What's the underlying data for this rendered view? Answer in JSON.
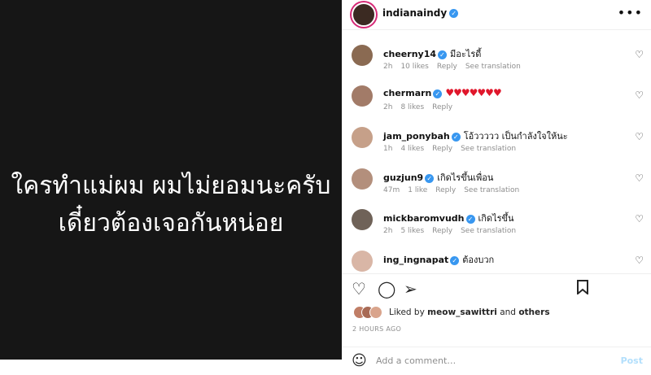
{
  "media": {
    "caption_line1": "ใครทำแม่ผม ผมไม่ยอมนะครับ",
    "caption_line2": "เดี๋ยวต้องเจอกันหน่อย"
  },
  "header": {
    "username": "indianaindy",
    "more": "•••"
  },
  "comments": [
    {
      "user": "cheerny14",
      "text": "มีอะไรดี้",
      "time": "2h",
      "likes": "10 likes",
      "reply": "Reply",
      "translate": "See translation",
      "avatar_color": "#8a6a52"
    },
    {
      "user": "chermarn",
      "text": "♥♥♥♥♥♥♥",
      "time": "2h",
      "likes": "8 likes",
      "reply": "Reply",
      "translate": "",
      "avatar_color": "#a27b68"
    },
    {
      "user": "jam_ponybah",
      "text": "โอ้ววววว เป็นกำลังใจให้นะ",
      "time": "1h",
      "likes": "4 likes",
      "reply": "Reply",
      "translate": "See translation",
      "avatar_color": "#c6a089"
    },
    {
      "user": "guzjun9",
      "text": "เกิดไรขึ้นเพื่อน",
      "time": "47m",
      "likes": "1 like",
      "reply": "Reply",
      "translate": "See translation",
      "avatar_color": "#b38f7c"
    },
    {
      "user": "mickbaromvudh",
      "text": "เกิดไรขึ้น",
      "time": "2h",
      "likes": "5 likes",
      "reply": "Reply",
      "translate": "See translation",
      "avatar_color": "#6f6258"
    },
    {
      "user": "ing_ingnapat",
      "text": "ต้องบวก",
      "time": "",
      "likes": "",
      "reply": "",
      "translate": "",
      "avatar_color": "#d9b6a6"
    }
  ],
  "actions": {
    "like_icon": "heart-outline-icon",
    "comment_icon": "comment-icon",
    "share_icon": "paper-plane-icon",
    "save_icon": "bookmark-icon"
  },
  "likes": {
    "prefix": "Liked by",
    "user": "meow_sawittri",
    "and": "and",
    "others": "others"
  },
  "timestamp": "2 HOURS AGO",
  "add_comment": {
    "placeholder": "Add a comment…",
    "post": "Post"
  }
}
